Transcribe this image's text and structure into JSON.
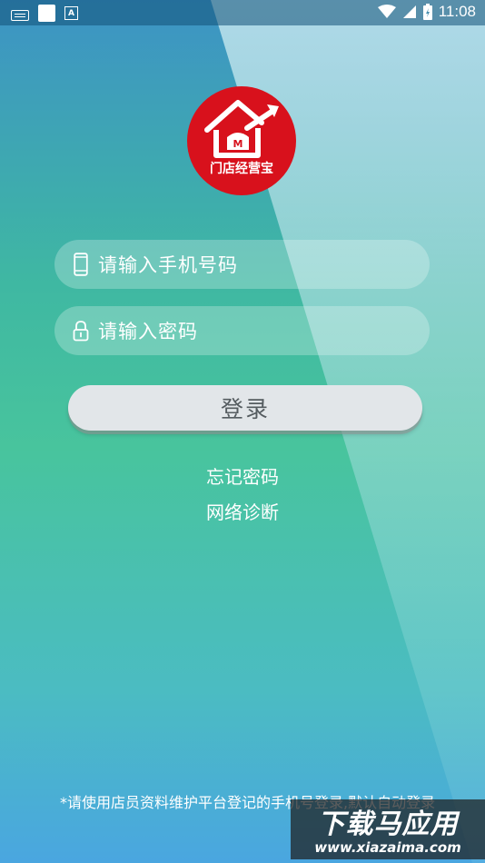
{
  "status_bar": {
    "time": "11:08",
    "icons": [
      "keyboard-icon",
      "notification-square-icon",
      "a-app-icon",
      "wifi-icon",
      "signal-icon",
      "battery-icon"
    ]
  },
  "logo": {
    "text": "门店经营宝",
    "brand_color": "#d8111c"
  },
  "login_form": {
    "phone_placeholder": "请输入手机号码",
    "password_placeholder": "请输入密码",
    "login_button": "登录"
  },
  "links": {
    "forgot_password": "忘记密码",
    "network_diagnosis": "网络诊断"
  },
  "notice": "*请使用店员资料维护平台登记的手机号登录,默认自动登录",
  "watermark": {
    "main": "下载马应用",
    "sub": "www.xiazaima.com"
  }
}
